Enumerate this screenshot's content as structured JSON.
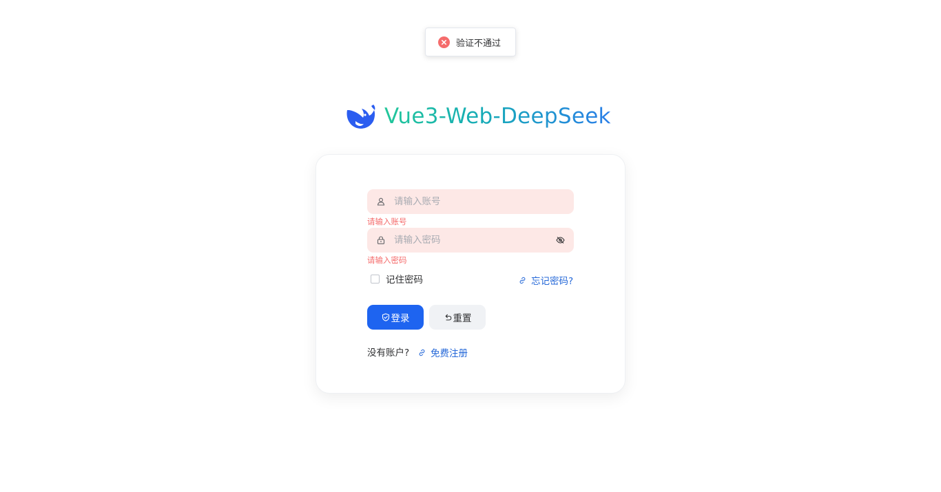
{
  "toast": {
    "message": "验证不通过",
    "icon": "error-circle-icon"
  },
  "brand": {
    "title": "Vue3-Web-DeepSeek",
    "logo": "deepseek-whale-logo"
  },
  "form": {
    "username": {
      "placeholder": "请输入账号",
      "value": "",
      "error": "请输入账号",
      "icon": "user-icon"
    },
    "password": {
      "placeholder": "请输入密码",
      "value": "",
      "error": "请输入密码",
      "icon": "lock-icon",
      "toggle_icon": "eye-off-icon"
    },
    "remember_label": "记住密码",
    "remember_checked": false,
    "forgot_label": "忘记密码?",
    "login_label": "登录",
    "reset_label": "重置",
    "no_account_label": "没有账户?",
    "register_label": "免费注册"
  },
  "colors": {
    "primary": "#1e64f0",
    "error": "#f56c6c",
    "field_error_bg": "#fde8e6",
    "link": "#2568d8",
    "brand_gradient_start": "#22c79a",
    "brand_gradient_end": "#2a7ee8"
  }
}
